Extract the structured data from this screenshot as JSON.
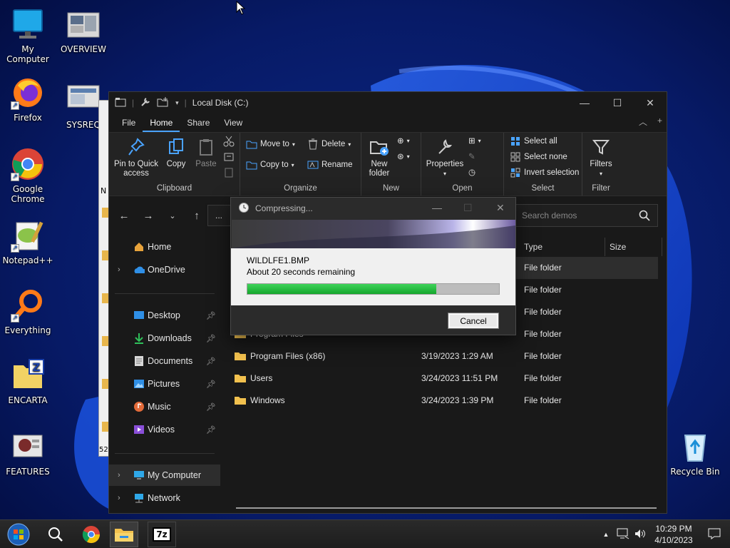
{
  "desktop": {
    "icons": [
      {
        "label": "My Computer"
      },
      {
        "label": "OVERVIEW"
      },
      {
        "label": "Firefox"
      },
      {
        "label": "SYSREQ"
      },
      {
        "label": "Google Chrome"
      },
      {
        "label": "Notepad++"
      },
      {
        "label": "Everything"
      },
      {
        "label": "ENCARTA"
      },
      {
        "label": "FEATURES"
      },
      {
        "label": "Recycle Bin"
      }
    ],
    "bg_window_text": [
      "N",
      "52"
    ]
  },
  "explorer": {
    "title": "Local Disk (C:)",
    "tabs": [
      "File",
      "Home",
      "Share",
      "View"
    ],
    "active_tab": "Home",
    "ribbon": {
      "clipboard": {
        "group": "Clipboard",
        "pin": "Pin to Quick access",
        "copy": "Copy",
        "paste": "Paste"
      },
      "organize": {
        "group": "Organize",
        "move_to": "Move to",
        "copy_to": "Copy to",
        "delete": "Delete",
        "rename": "Rename"
      },
      "new": {
        "group": "New",
        "new_folder": "New folder"
      },
      "open": {
        "group": "Open",
        "properties": "Properties"
      },
      "select": {
        "group": "Select",
        "select_all": "Select all",
        "select_none": "Select none",
        "invert": "Invert selection"
      },
      "filter": {
        "group": "Filter",
        "filters": "Filters"
      }
    },
    "address_text": "...",
    "search_placeholder": "Search demos",
    "nav": {
      "home": "Home",
      "onedrive": "OneDrive",
      "desktop": "Desktop",
      "downloads": "Downloads",
      "documents": "Documents",
      "pictures": "Pictures",
      "music": "Music",
      "videos": "Videos",
      "my_computer": "My Computer",
      "network": "Network"
    },
    "columns": {
      "type": "Type",
      "size": "Size"
    },
    "rows": [
      {
        "name": "",
        "date": "",
        "type": "File folder"
      },
      {
        "name": "",
        "date": "",
        "type": "File folder"
      },
      {
        "name": "",
        "date": "",
        "type": "File folder"
      },
      {
        "name": "Program Files",
        "date": "",
        "type": "File folder"
      },
      {
        "name": "Program Files (x86)",
        "date": "3/19/2023 1:29 AM",
        "type": "File folder"
      },
      {
        "name": "Users",
        "date": "3/24/2023 11:51 PM",
        "type": "File folder"
      },
      {
        "name": "Windows",
        "date": "3/24/2023 1:39 PM",
        "type": "File folder"
      }
    ]
  },
  "dialog": {
    "title": "Compressing...",
    "file": "WILDLFE1.BMP",
    "remaining": "About 20 seconds remaining",
    "progress": 0.75,
    "cancel": "Cancel"
  },
  "taskbar": {
    "time": "10:29 PM",
    "date": "4/10/2023",
    "sevenzip_label": "7z"
  }
}
